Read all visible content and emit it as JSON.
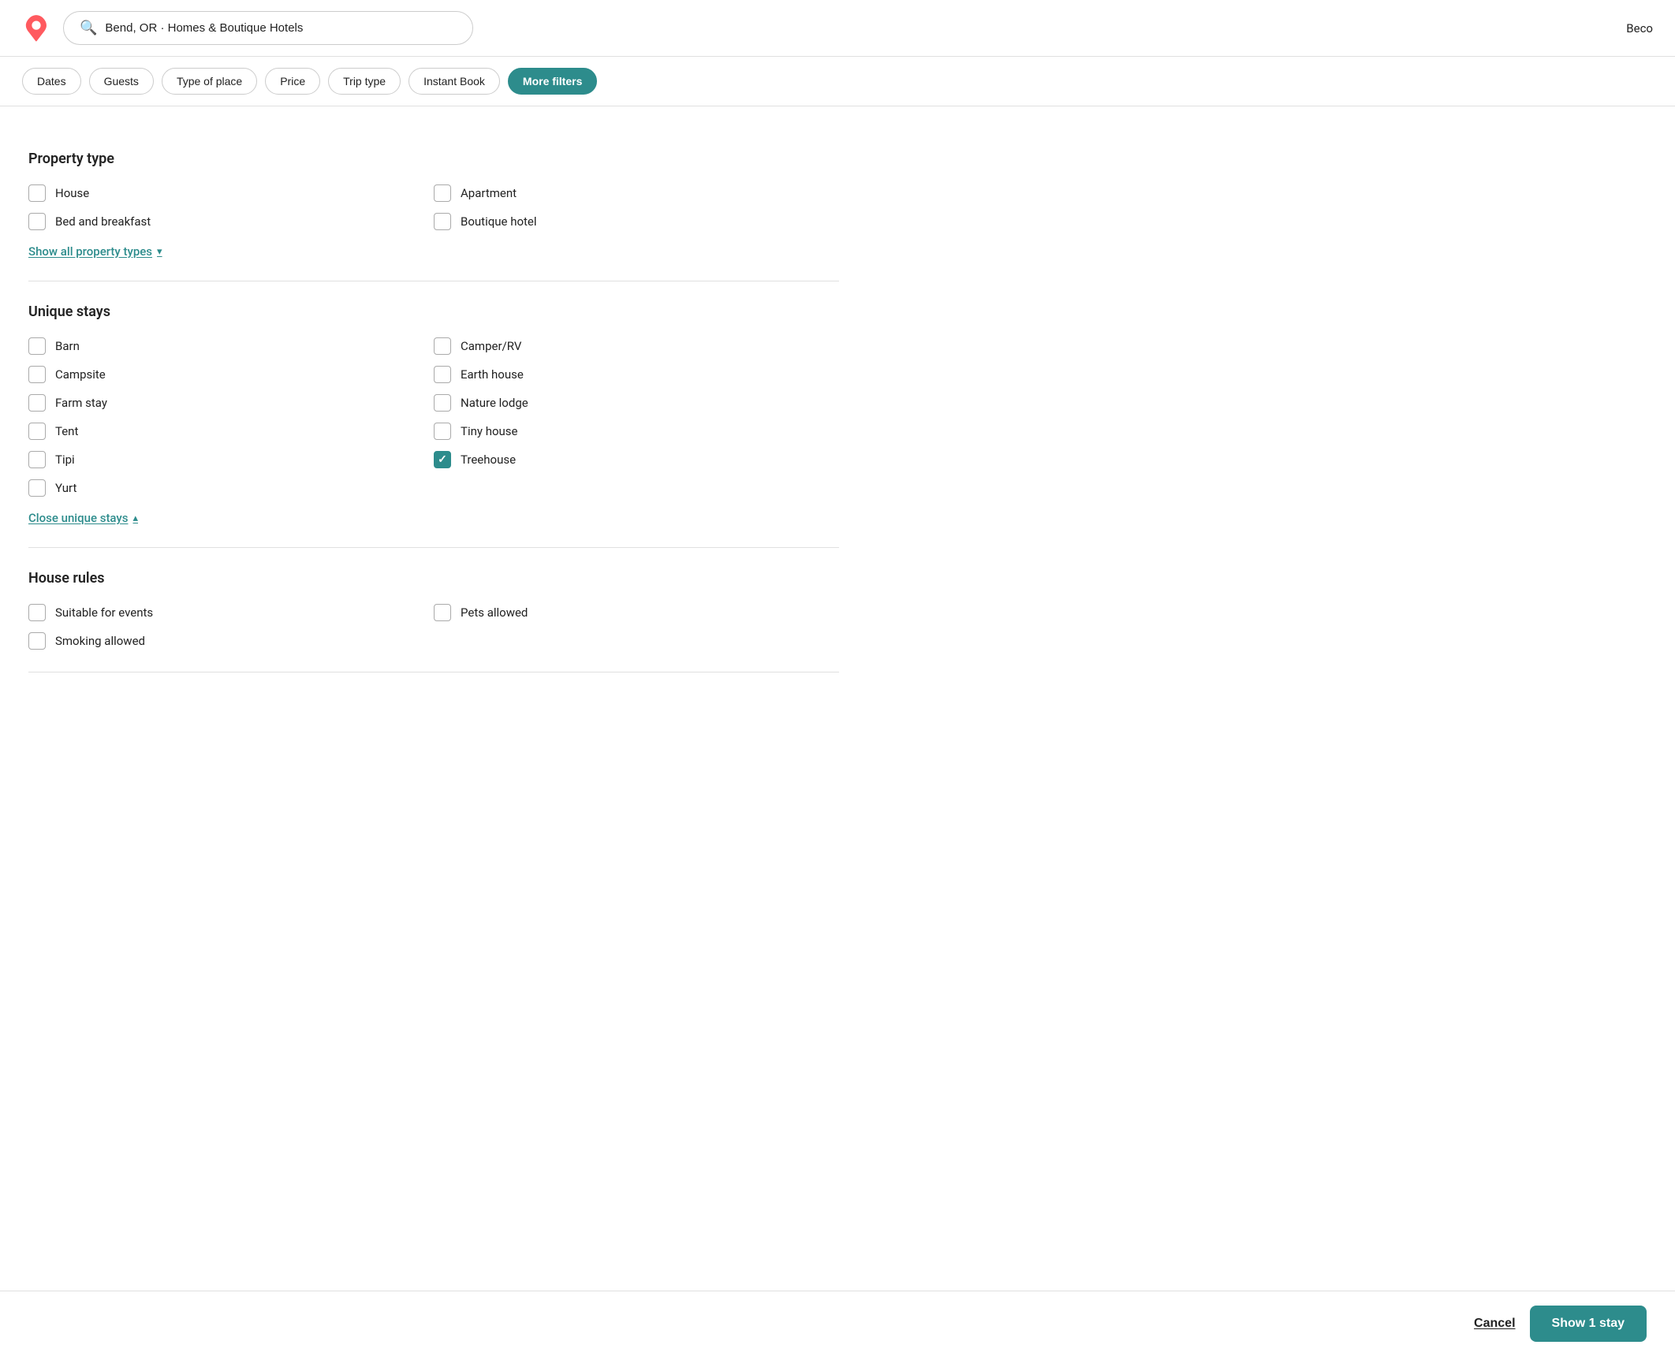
{
  "header": {
    "logo_alt": "Airbnb",
    "search_value": "Bend, OR · Homes & Boutique Hotels",
    "search_placeholder": "Bend, OR · Homes & Boutique Hotels",
    "user_label": "Beco"
  },
  "filter_bar": {
    "buttons": [
      {
        "id": "dates",
        "label": "Dates",
        "active": false
      },
      {
        "id": "guests",
        "label": "Guests",
        "active": false
      },
      {
        "id": "type-of-place",
        "label": "Type of place",
        "active": false
      },
      {
        "id": "price",
        "label": "Price",
        "active": false
      },
      {
        "id": "trip-type",
        "label": "Trip type",
        "active": false
      },
      {
        "id": "instant-book",
        "label": "Instant Book",
        "active": false
      },
      {
        "id": "more-filters",
        "label": "More filters",
        "active": true
      }
    ]
  },
  "property_type": {
    "title": "Property type",
    "items_left": [
      {
        "id": "house",
        "label": "House",
        "checked": false
      },
      {
        "id": "bed-breakfast",
        "label": "Bed and breakfast",
        "checked": false
      }
    ],
    "items_right": [
      {
        "id": "apartment",
        "label": "Apartment",
        "checked": false
      },
      {
        "id": "boutique-hotel",
        "label": "Boutique hotel",
        "checked": false
      }
    ],
    "toggle_label": "Show all property types",
    "toggle_arrow": "▾"
  },
  "unique_stays": {
    "title": "Unique stays",
    "items_left": [
      {
        "id": "barn",
        "label": "Barn",
        "checked": false
      },
      {
        "id": "campsite",
        "label": "Campsite",
        "checked": false
      },
      {
        "id": "farm-stay",
        "label": "Farm stay",
        "checked": false
      },
      {
        "id": "tent",
        "label": "Tent",
        "checked": false
      },
      {
        "id": "tipi",
        "label": "Tipi",
        "checked": false
      },
      {
        "id": "yurt",
        "label": "Yurt",
        "checked": false
      }
    ],
    "items_right": [
      {
        "id": "camper-rv",
        "label": "Camper/RV",
        "checked": false
      },
      {
        "id": "earth-house",
        "label": "Earth house",
        "checked": false
      },
      {
        "id": "nature-lodge",
        "label": "Nature lodge",
        "checked": false
      },
      {
        "id": "tiny-house",
        "label": "Tiny house",
        "checked": false
      },
      {
        "id": "treehouse",
        "label": "Treehouse",
        "checked": true
      },
      {
        "id": "placeholder",
        "label": "",
        "checked": false
      }
    ],
    "toggle_label": "Close unique stays",
    "toggle_arrow": "▴"
  },
  "house_rules": {
    "title": "House rules",
    "items_left": [
      {
        "id": "suitable-events",
        "label": "Suitable for events",
        "checked": false
      },
      {
        "id": "smoking-allowed",
        "label": "Smoking allowed",
        "checked": false
      }
    ],
    "items_right": [
      {
        "id": "pets-allowed",
        "label": "Pets allowed",
        "checked": false
      }
    ]
  },
  "footer": {
    "cancel_label": "Cancel",
    "show_label": "Show 1 stay"
  },
  "icons": {
    "search": "🔍",
    "check": "✓",
    "chevron_down": "▾",
    "chevron_up": "▴"
  },
  "colors": {
    "teal": "#2d8c8c",
    "border": "#e0e0e0",
    "text": "#222",
    "muted": "#aaa"
  }
}
